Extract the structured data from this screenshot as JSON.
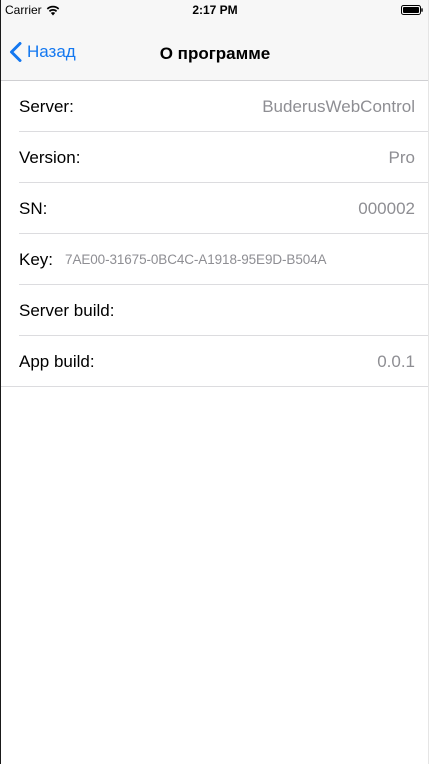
{
  "status_bar": {
    "carrier": "Carrier",
    "time": "2:17 PM"
  },
  "nav": {
    "back_label": "Назад",
    "title": "О программе"
  },
  "rows": [
    {
      "label": "Server:",
      "value": "BuderusWebControl"
    },
    {
      "label": "Version:",
      "value": "Pro"
    },
    {
      "label": "SN:",
      "value": "000002"
    },
    {
      "label": "Key:",
      "value": "7AE00-31675-0BC4C-A1918-95E9D-B504A"
    },
    {
      "label": "Server build:",
      "value": ""
    },
    {
      "label": "App build:",
      "value": "0.0.1"
    }
  ],
  "colors": {
    "accent": "#1478f0",
    "value_text": "#8e8e93",
    "bar_background": "#f7f7f7"
  }
}
